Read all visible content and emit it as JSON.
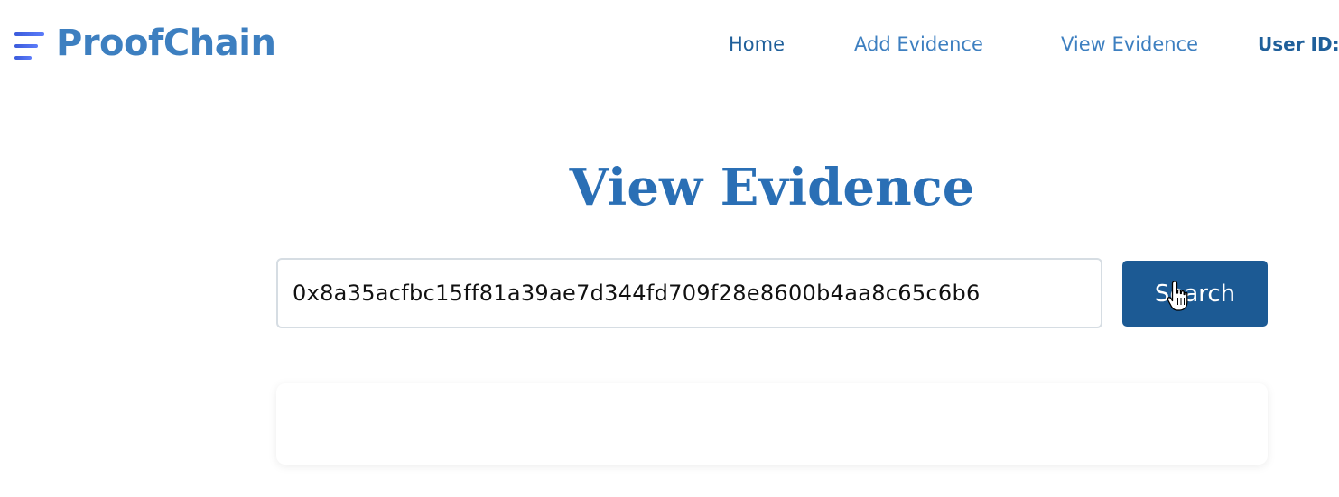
{
  "brand": {
    "name": "ProofChain",
    "icon": "menu-lines-icon"
  },
  "nav": {
    "home": "Home",
    "add_evidence": "Add Evidence",
    "view_evidence": "View Evidence",
    "user_id_label": "User ID:"
  },
  "main": {
    "title": "View Evidence",
    "search": {
      "value": "0x8a35acfbc15ff81a39ae7d344fd709f28e8600b4aa8c65c6b6",
      "button_label": "Search"
    }
  },
  "colors": {
    "brand": "#3d7fc0",
    "title": "#2a6fb5",
    "button": "#1c5a94"
  }
}
